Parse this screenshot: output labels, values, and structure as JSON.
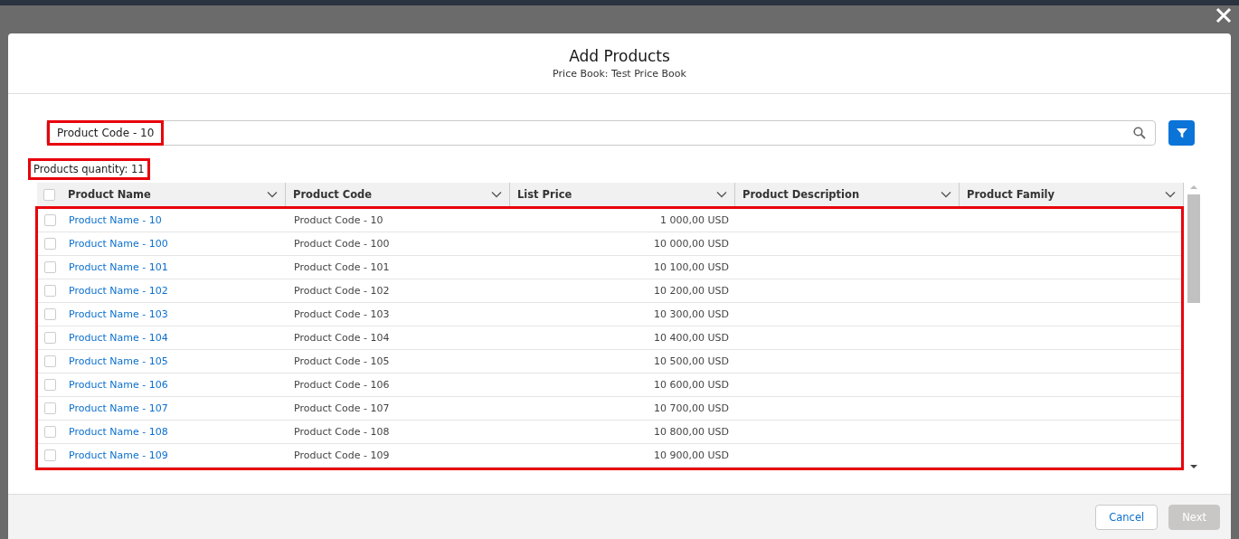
{
  "modal": {
    "title": "Add Products",
    "subtitle": "Price Book: Test Price Book"
  },
  "search": {
    "value": "Product Code - 10",
    "highlighted": true
  },
  "quantity": {
    "text": "Products quantity: 11",
    "highlighted": true
  },
  "table": {
    "highlighted": true,
    "all_selected": false,
    "columns": [
      "Product Name",
      "Product Code",
      "List Price",
      "Product Description",
      "Product Family"
    ],
    "rows": [
      {
        "selected": false,
        "cells": [
          "Product Name - 10",
          "Product Code - 10",
          "1 000,00 USD"
        ]
      },
      {
        "selected": false,
        "cells": [
          "Product Name - 100",
          "Product Code - 100",
          "10 000,00 USD"
        ]
      },
      {
        "selected": false,
        "cells": [
          "Product Name - 101",
          "Product Code - 101",
          "10 100,00 USD"
        ]
      },
      {
        "selected": false,
        "cells": [
          "Product Name - 102",
          "Product Code - 102",
          "10 200,00 USD"
        ]
      },
      {
        "selected": false,
        "cells": [
          "Product Name - 103",
          "Product Code - 103",
          "10 300,00 USD"
        ]
      },
      {
        "selected": false,
        "cells": [
          "Product Name - 104",
          "Product Code - 104",
          "10 400,00 USD"
        ]
      },
      {
        "selected": false,
        "cells": [
          "Product Name - 105",
          "Product Code - 105",
          "10 500,00 USD"
        ]
      },
      {
        "selected": false,
        "cells": [
          "Product Name - 106",
          "Product Code - 106",
          "10 600,00 USD"
        ]
      },
      {
        "selected": false,
        "cells": [
          "Product Name - 107",
          "Product Code - 107",
          "10 700,00 USD"
        ]
      },
      {
        "selected": false,
        "cells": [
          "Product Name - 108",
          "Product Code - 108",
          "10 800,00 USD"
        ]
      },
      {
        "selected": false,
        "cells": [
          "Product Name - 109",
          "Product Code - 109",
          "10 900,00 USD"
        ]
      }
    ]
  },
  "footer": {
    "buttons": [
      {
        "label": "Cancel",
        "disabled": false
      },
      {
        "label": "Next",
        "disabled": true
      }
    ]
  }
}
